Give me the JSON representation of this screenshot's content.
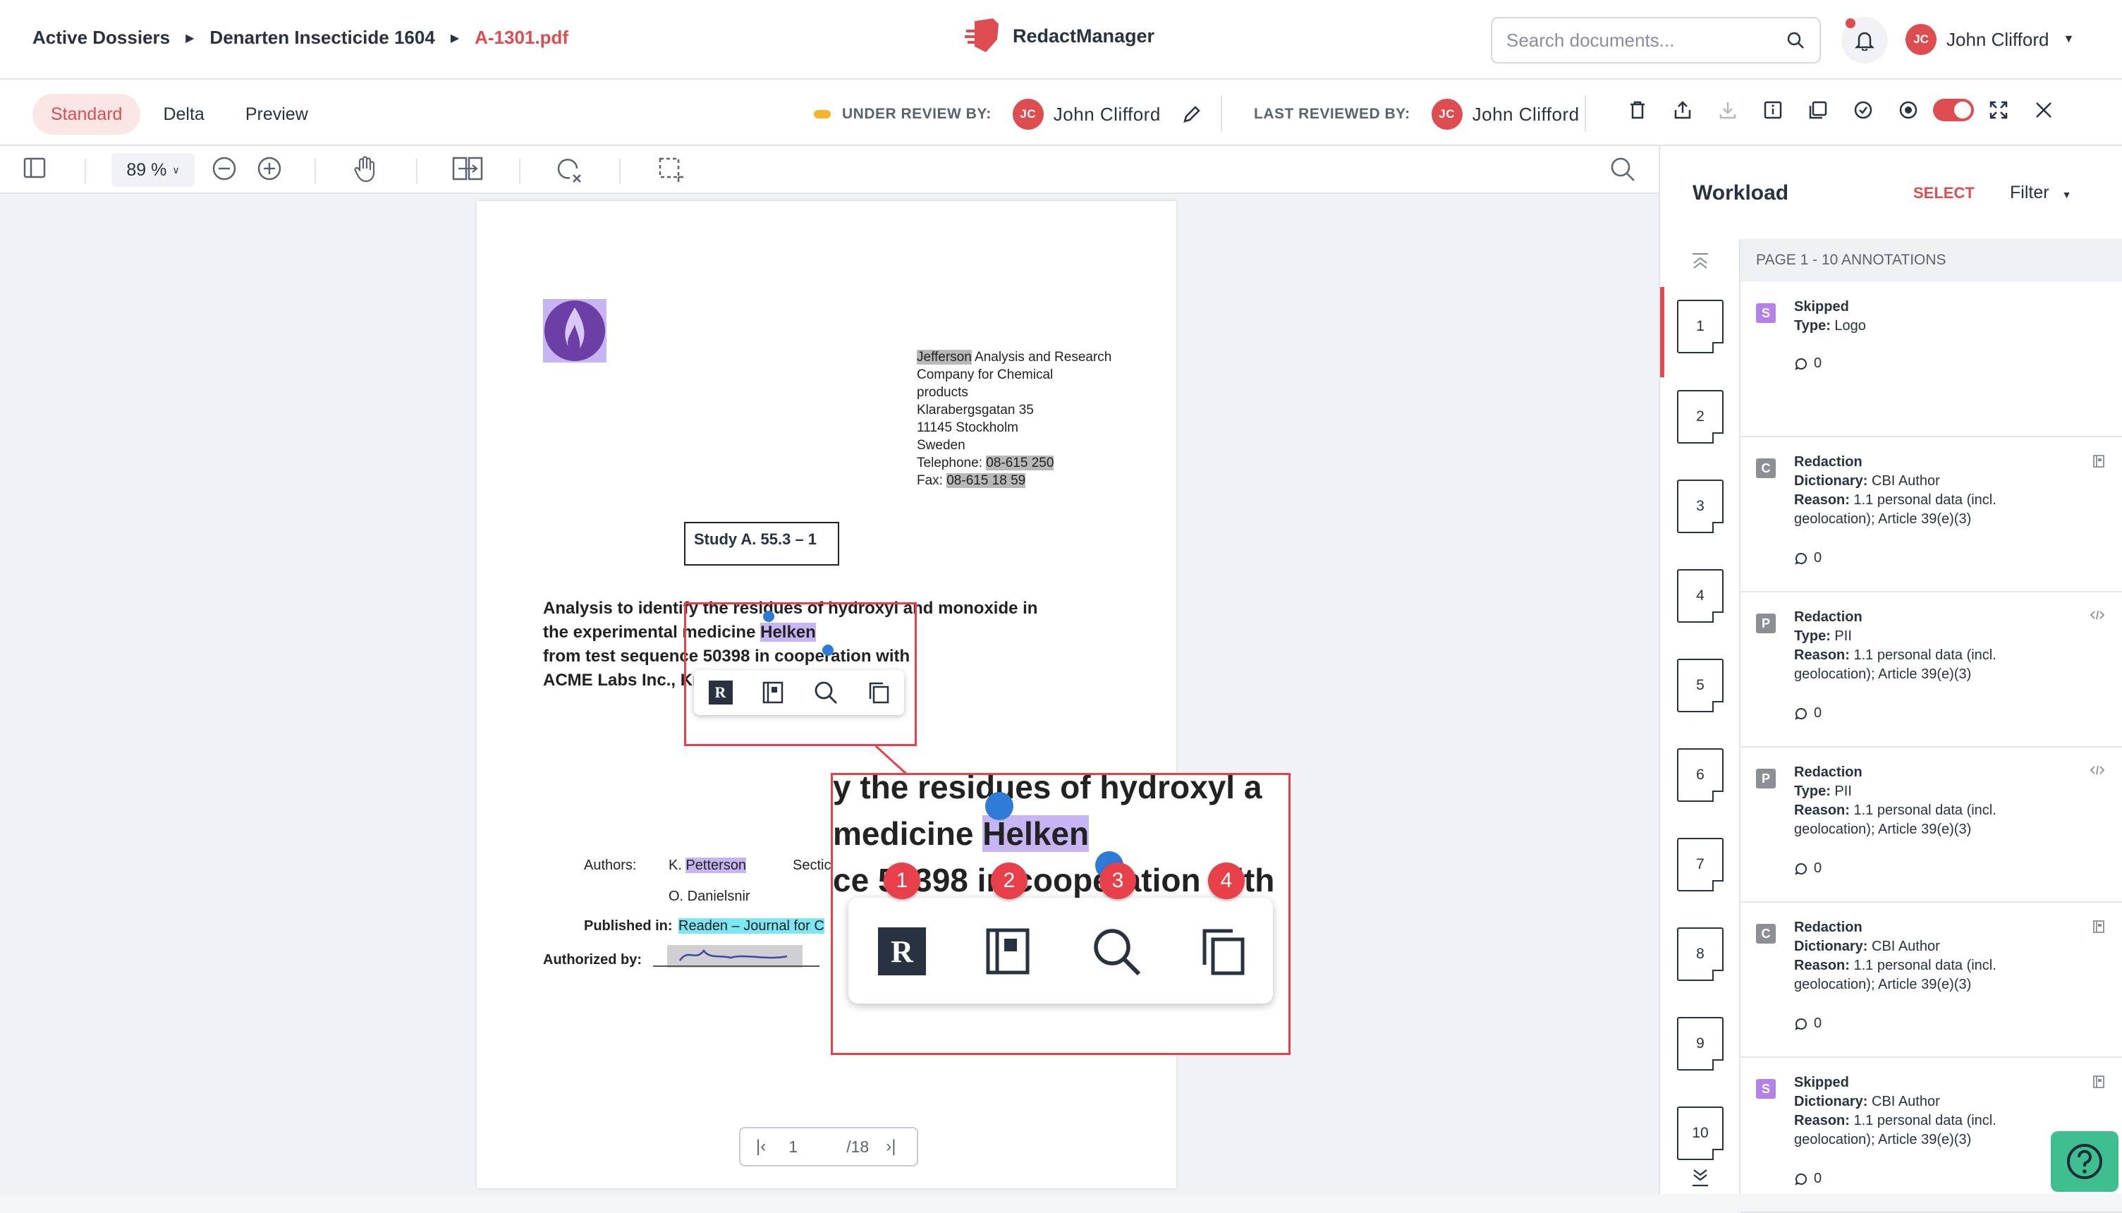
{
  "breadcrumb": {
    "root": "Active Dossiers",
    "dossier": "Denarten Insecticide 1604",
    "file": "A-1301.pdf"
  },
  "app": {
    "name": "RedactManager"
  },
  "search": {
    "placeholder": "Search documents..."
  },
  "user": {
    "initials": "JC",
    "name": "John Clifford"
  },
  "tabs": [
    {
      "label": "Standard"
    },
    {
      "label": "Delta"
    },
    {
      "label": "Preview"
    }
  ],
  "review": {
    "under_label": "UNDER REVIEW BY:",
    "under_name": "John Clifford",
    "last_label": "LAST REVIEWED BY:",
    "last_name": "John Clifford"
  },
  "viewer": {
    "zoom": "89 %",
    "current_page": "1",
    "total_pages": "/18"
  },
  "document": {
    "address": [
      "Jefferson",
      " Analysis and Research",
      "Company for Chemical",
      "products",
      "Klarabergsgatan 35",
      "11145 Stockholm",
      "Sweden",
      "Telephone: ",
      "08-615 250",
      "Fax: ",
      "08-615 18 59"
    ],
    "study": "Study A. 55.3 – 1",
    "title_line1": "Analysis to identify the residues of hydroxyl and monoxide in",
    "title_line2_pre": "the experimental medicine ",
    "title_line2_hl": "Helken",
    "title_line3": "from test sequence 50398 in cooperation with",
    "title_line4": "ACME Labs Inc., Kr",
    "authors_label": "Authors:",
    "author1_initial": "K. ",
    "author1": "Petterson",
    "author2": "O. Danielsnir",
    "section_label": "Sectic",
    "published_label": "Published in:",
    "published": "Readen – Journal for C",
    "authorized_label": "Authorized by:"
  },
  "zoom_panel": {
    "line1": "y the residues of hydroxyl a",
    "line2_pre": " medicine ",
    "line2_hl": "Helken",
    "line3": "ce 50398 in cooperation with",
    "markers": [
      "1",
      "2",
      "3",
      "4"
    ],
    "redact_glyph": "R"
  },
  "workload": {
    "title": "Workload",
    "select": "SELECT",
    "filter": "Filter",
    "header": "PAGE 1 - 10 ANNOTATIONS",
    "pages": [
      "1",
      "2",
      "3",
      "4",
      "5",
      "6",
      "7",
      "8",
      "9",
      "10"
    ],
    "annotations": [
      {
        "badge": "S",
        "color": "#b681e6",
        "title": "Skipped",
        "line1_label": "Type:",
        "line1": " Logo",
        "reason_label": "",
        "reason": "",
        "reason2": "",
        "comments": "0",
        "corner": ""
      },
      {
        "badge": "C",
        "color": "#8c8f96",
        "title": "Redaction",
        "line1_label": "Dictionary:",
        "line1": " CBI Author",
        "reason_label": "Reason:",
        "reason": " 1.1 personal data (incl.",
        "reason2": "geolocation); Article 39(e)(3)",
        "comments": "0",
        "corner": "doc"
      },
      {
        "badge": "P",
        "color": "#8c8f96",
        "title": "Redaction",
        "line1_label": "Type:",
        "line1": " PII",
        "reason_label": "Reason:",
        "reason": " 1.1 personal data (incl.",
        "reason2": "geolocation); Article 39(e)(3)",
        "comments": "0",
        "corner": "code"
      },
      {
        "badge": "P",
        "color": "#8c8f96",
        "title": "Redaction",
        "line1_label": "Type:",
        "line1": " PII",
        "reason_label": "Reason:",
        "reason": " 1.1 personal data (incl.",
        "reason2": "geolocation); Article 39(e)(3)",
        "comments": "0",
        "corner": "code"
      },
      {
        "badge": "C",
        "color": "#8c8f96",
        "title": "Redaction",
        "line1_label": "Dictionary:",
        "line1": " CBI Author",
        "reason_label": "Reason:",
        "reason": " 1.1 personal data (incl.",
        "reason2": "geolocation); Article 39(e)(3)",
        "comments": "0",
        "corner": "doc"
      },
      {
        "badge": "S",
        "color": "#b681e6",
        "title": "Skipped",
        "line1_label": "Dictionary:",
        "line1": " CBI Author",
        "reason_label": "Reason:",
        "reason": " 1.1 personal data (incl.",
        "reason2": "geolocation); Article 39(e)(3)",
        "comments": "0",
        "corner": "doc"
      }
    ]
  },
  "colors": {
    "accent": "#dd4d50",
    "highlight_redaction": "#c6b5f2",
    "highlight_hint": "#7ee5f2",
    "callout": "#e8404b",
    "help": "#3fbf8f"
  }
}
